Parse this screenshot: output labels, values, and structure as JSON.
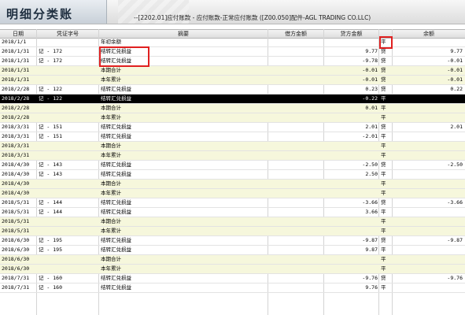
{
  "window": {
    "title": "明细分类账",
    "account_info": "--[2202.01]应付账款 - 应付账款-正常应付账款 ([Z00.050]配件-AGL TRADING CO.LLC)"
  },
  "columns": [
    "日期",
    "凭证字号",
    "摘要",
    "借方金额",
    "贷方金额",
    "",
    "余额"
  ],
  "rows": [
    {
      "type": "normal",
      "date": "2018/1/1",
      "voucher": "",
      "summary": "年初余额",
      "debit": "",
      "credit": "",
      "dir": "平",
      "balance": ""
    },
    {
      "type": "normal",
      "date": "2018/1/31",
      "voucher": "记 - 172",
      "summary": "结转汇兑损益",
      "debit": "",
      "credit": "9.77",
      "dir": "贷",
      "balance": "9.77"
    },
    {
      "type": "normal",
      "date": "2018/1/31",
      "voucher": "记 - 172",
      "summary": "结转汇兑损益",
      "debit": "",
      "credit": "-9.78",
      "dir": "贷",
      "balance": "-0.01"
    },
    {
      "type": "sum",
      "date": "2018/1/31",
      "voucher": "",
      "summary": "本期合计",
      "debit": "",
      "credit": "-0.01",
      "dir": "贷",
      "balance": "-0.01"
    },
    {
      "type": "sum",
      "date": "2018/1/31",
      "voucher": "",
      "summary": "本年累计",
      "debit": "",
      "credit": "-0.01",
      "dir": "贷",
      "balance": "-0.01"
    },
    {
      "type": "normal",
      "date": "2018/2/28",
      "voucher": "记 - 122",
      "summary": "结转汇兑损益",
      "debit": "",
      "credit": "0.23",
      "dir": "贷",
      "balance": "0.22"
    },
    {
      "type": "sel",
      "date": "2018/2/28",
      "voucher": "记 - 122",
      "summary": "结转汇兑损益",
      "debit": "",
      "credit": "-0.22",
      "dir": "平",
      "balance": ""
    },
    {
      "type": "sum",
      "date": "2018/2/28",
      "voucher": "",
      "summary": "本期合计",
      "debit": "",
      "credit": "0.01",
      "dir": "平",
      "balance": ""
    },
    {
      "type": "sum",
      "date": "2018/2/28",
      "voucher": "",
      "summary": "本年累计",
      "debit": "",
      "credit": "",
      "dir": "平",
      "balance": ""
    },
    {
      "type": "normal",
      "date": "2018/3/31",
      "voucher": "记 - 151",
      "summary": "结转汇兑损益",
      "debit": "",
      "credit": "2.01",
      "dir": "贷",
      "balance": "2.01"
    },
    {
      "type": "normal",
      "date": "2018/3/31",
      "voucher": "记 - 151",
      "summary": "结转汇兑损益",
      "debit": "",
      "credit": "-2.01",
      "dir": "平",
      "balance": ""
    },
    {
      "type": "sum",
      "date": "2018/3/31",
      "voucher": "",
      "summary": "本期合计",
      "debit": "",
      "credit": "",
      "dir": "平",
      "balance": ""
    },
    {
      "type": "sum",
      "date": "2018/3/31",
      "voucher": "",
      "summary": "本年累计",
      "debit": "",
      "credit": "",
      "dir": "平",
      "balance": ""
    },
    {
      "type": "normal",
      "date": "2018/4/30",
      "voucher": "记 - 143",
      "summary": "结转汇兑损益",
      "debit": "",
      "credit": "-2.50",
      "dir": "贷",
      "balance": "-2.50"
    },
    {
      "type": "normal",
      "date": "2018/4/30",
      "voucher": "记 - 143",
      "summary": "结转汇兑损益",
      "debit": "",
      "credit": "2.50",
      "dir": "平",
      "balance": ""
    },
    {
      "type": "sum",
      "date": "2018/4/30",
      "voucher": "",
      "summary": "本期合计",
      "debit": "",
      "credit": "",
      "dir": "平",
      "balance": ""
    },
    {
      "type": "sum",
      "date": "2018/4/30",
      "voucher": "",
      "summary": "本年累计",
      "debit": "",
      "credit": "",
      "dir": "平",
      "balance": ""
    },
    {
      "type": "normal",
      "date": "2018/5/31",
      "voucher": "记 - 144",
      "summary": "结转汇兑损益",
      "debit": "",
      "credit": "-3.66",
      "dir": "贷",
      "balance": "-3.66"
    },
    {
      "type": "normal",
      "date": "2018/5/31",
      "voucher": "记 - 144",
      "summary": "结转汇兑损益",
      "debit": "",
      "credit": "3.66",
      "dir": "平",
      "balance": ""
    },
    {
      "type": "sum",
      "date": "2018/5/31",
      "voucher": "",
      "summary": "本期合计",
      "debit": "",
      "credit": "",
      "dir": "平",
      "balance": ""
    },
    {
      "type": "sum",
      "date": "2018/5/31",
      "voucher": "",
      "summary": "本年累计",
      "debit": "",
      "credit": "",
      "dir": "平",
      "balance": ""
    },
    {
      "type": "normal",
      "date": "2018/6/30",
      "voucher": "记 - 195",
      "summary": "结转汇兑损益",
      "debit": "",
      "credit": "-9.87",
      "dir": "贷",
      "balance": "-9.87"
    },
    {
      "type": "normal",
      "date": "2018/6/30",
      "voucher": "记 - 195",
      "summary": "结转汇兑损益",
      "debit": "",
      "credit": "9.87",
      "dir": "平",
      "balance": ""
    },
    {
      "type": "sum",
      "date": "2018/6/30",
      "voucher": "",
      "summary": "本期合计",
      "debit": "",
      "credit": "",
      "dir": "平",
      "balance": ""
    },
    {
      "type": "sum",
      "date": "2018/6/30",
      "voucher": "",
      "summary": "本年累计",
      "debit": "",
      "credit": "",
      "dir": "平",
      "balance": ""
    },
    {
      "type": "normal",
      "date": "2018/7/31",
      "voucher": "记 - 160",
      "summary": "结转汇兑损益",
      "debit": "",
      "credit": "-9.76",
      "dir": "贷",
      "balance": "-9.76"
    },
    {
      "type": "normal",
      "date": "2018/7/31",
      "voucher": "记 - 160",
      "summary": "结转汇兑损益",
      "debit": "",
      "credit": "9.76",
      "dir": "平",
      "balance": ""
    }
  ],
  "colors": {
    "highlight_box": "#e02020",
    "selected_row": "#000000",
    "summary_row": "#f6f7dc"
  }
}
